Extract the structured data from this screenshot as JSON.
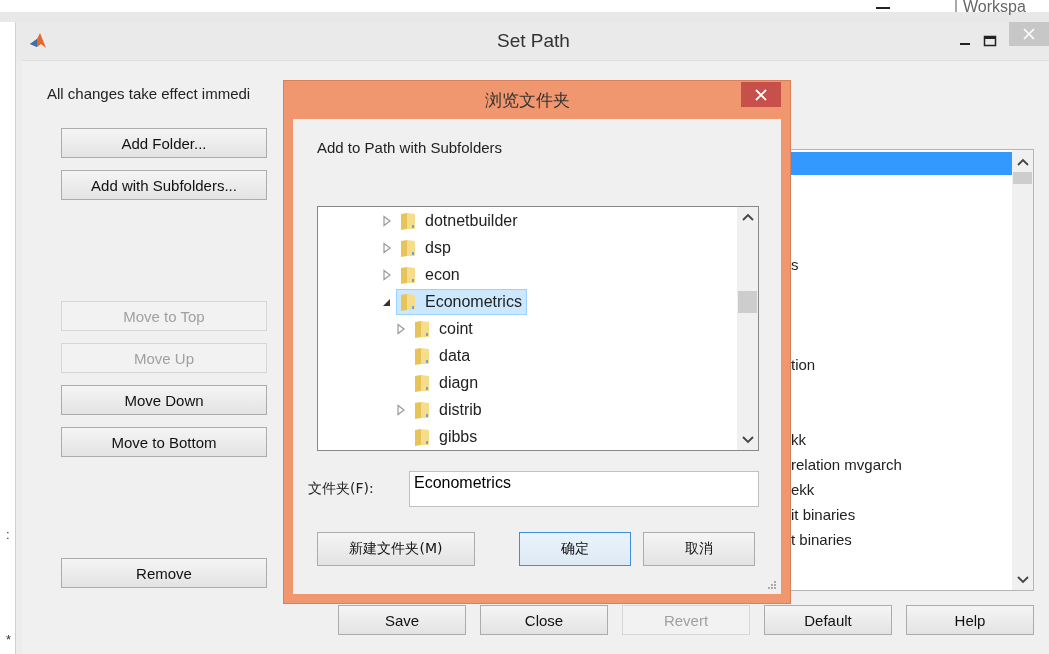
{
  "background_app": {
    "tab": "Workspa"
  },
  "gutter_marks": [
    ":",
    "*"
  ],
  "window": {
    "title": "Set Path"
  },
  "intro": "All changes take effect immedi",
  "button_groups": [
    {
      "buttons": [
        {
          "label": "Add Folder...",
          "disabled": false
        },
        {
          "label": "Add with Subfolders...",
          "disabled": false
        }
      ]
    },
    {
      "buttons": [
        {
          "label": "Move to Top",
          "disabled": true
        },
        {
          "label": "Move Up",
          "disabled": true
        },
        {
          "label": "Move Down",
          "disabled": false
        },
        {
          "label": "Move to Bottom",
          "disabled": false
        }
      ]
    },
    {
      "buttons": [
        {
          "label": "Remove",
          "disabled": false
        }
      ]
    }
  ],
  "path_list": [
    {
      "selected": true
    },
    {
      "selected": false
    },
    {
      "selected": false
    },
    {
      "selected": false
    },
    {
      "text": "s",
      "selected": false
    },
    {
      "selected": false
    },
    {
      "selected": false
    },
    {
      "selected": false
    },
    {
      "text": "tion",
      "selected": false
    },
    {
      "selected": false
    },
    {
      "selected": false
    },
    {
      "text": "kk",
      "selected": false
    },
    {
      "text": "relation mvgarch",
      "selected": false
    },
    {
      "text": "ekk",
      "selected": false
    },
    {
      "text": "it binaries",
      "selected": false
    },
    {
      "text": "t binaries",
      "selected": false
    }
  ],
  "footer_buttons": [
    {
      "label": "Save",
      "disabled": false
    },
    {
      "label": "Close",
      "disabled": false
    },
    {
      "label": "Revert",
      "disabled": true
    },
    {
      "label": "Default",
      "disabled": false
    },
    {
      "label": "Help",
      "disabled": false
    }
  ],
  "dialog": {
    "title": "浏览文件夹",
    "prompt": "Add to Path with Subfolders",
    "tree": [
      {
        "label": "dotnetbuilder",
        "expandable": true,
        "expanded": false,
        "selected": false
      },
      {
        "label": "dsp",
        "expandable": true,
        "expanded": false,
        "selected": false
      },
      {
        "label": "econ",
        "expandable": true,
        "expanded": false,
        "selected": false
      },
      {
        "label": "Econometrics",
        "expandable": true,
        "expanded": true,
        "selected": true,
        "children": [
          {
            "label": "coint",
            "expandable": true,
            "expanded": false,
            "selected": false
          },
          {
            "label": "data",
            "expandable": false,
            "selected": false
          },
          {
            "label": "diagn",
            "expandable": false,
            "selected": false
          },
          {
            "label": "distrib",
            "expandable": true,
            "expanded": false,
            "selected": false
          },
          {
            "label": "gibbs",
            "expandable": false,
            "selected": false
          }
        ]
      }
    ],
    "folder_label": "文件夹(F):",
    "folder_value": "Econometrics",
    "buttons": [
      {
        "label": "新建文件夹(M)",
        "default": false
      },
      {
        "label": "确定",
        "default": true
      },
      {
        "label": "取消",
        "default": false
      }
    ]
  }
}
